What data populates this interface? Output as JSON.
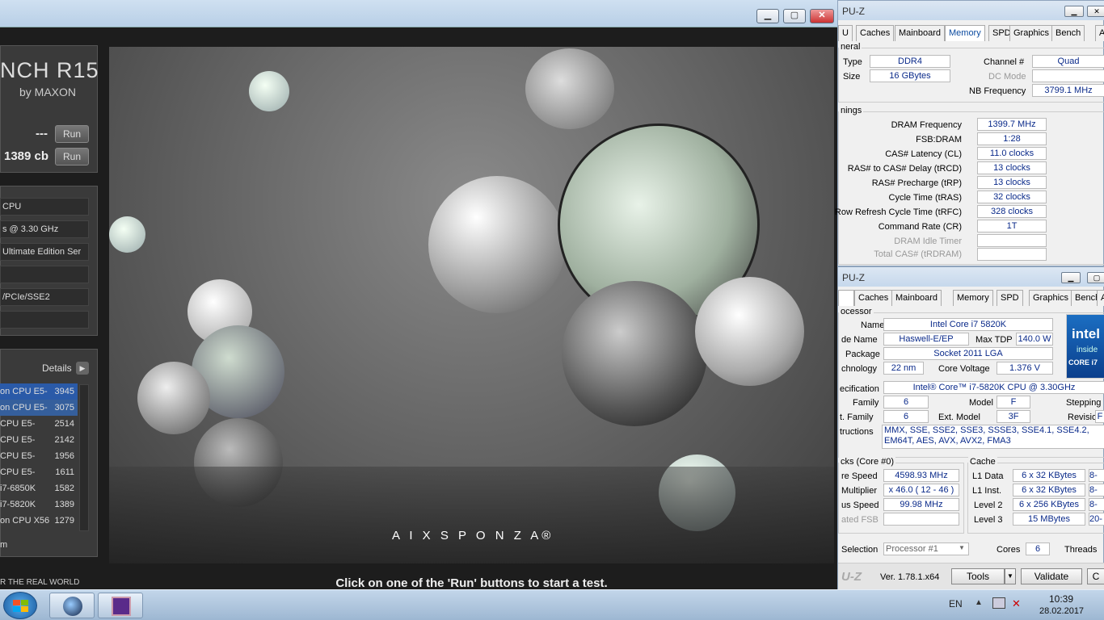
{
  "cinebench": {
    "logo": "NCH R15",
    "by": "by MAXON",
    "opengl_score": "---",
    "cpu_score": "1389 cb",
    "run_label": "Run",
    "info": [
      "CPU",
      "s @ 3.30 GHz",
      "Ultimate Edition Ser",
      "",
      "/PCIe/SSE2",
      ""
    ],
    "details_label": "Details",
    "ranking": [
      {
        "name": "on CPU E5-",
        "score": "3945"
      },
      {
        "name": "on CPU E5-",
        "score": "3075"
      },
      {
        "name": "CPU E5-",
        "score": "2514"
      },
      {
        "name": "CPU E5-",
        "score": "2142"
      },
      {
        "name": "CPU E5-",
        "score": "1956"
      },
      {
        "name": "CPU E5-",
        "score": "1611"
      },
      {
        "name": "i7-6850K",
        "score": "1582"
      },
      {
        "name": "i7-5820K",
        "score": "1389"
      },
      {
        "name": "on CPU X56",
        "score": "1279"
      }
    ],
    "bottom_item": "m",
    "tagline": "R THE REAL WORLD",
    "message": "Click on one of the 'Run' buttons to start a test.",
    "render_logo": "A I X S P O N Z A®",
    "highlight_color": "#2a5aa8"
  },
  "cpuz_memory": {
    "title": "PU-Z",
    "tabs": [
      "U",
      "Caches",
      "Mainboard",
      "Memory",
      "SPD",
      "Graphics",
      "Bench",
      "A"
    ],
    "active_tab": "Memory",
    "general_label": "neral",
    "type_label": "Type",
    "type": "DDR4",
    "size_label": "Size",
    "size": "16 GBytes",
    "channel_label": "Channel #",
    "channel": "Quad",
    "dcmode_label": "DC Mode",
    "dcmode": "",
    "nbfreq_label": "NB Frequency",
    "nbfreq": "3799.1 MHz",
    "timings_label": "nings",
    "timings": [
      {
        "label": "DRAM Frequency",
        "value": "1399.7 MHz",
        "grey": false
      },
      {
        "label": "FSB:DRAM",
        "value": "1:28",
        "grey": false
      },
      {
        "label": "CAS# Latency (CL)",
        "value": "11.0 clocks",
        "grey": false
      },
      {
        "label": "RAS# to CAS# Delay (tRCD)",
        "value": "13 clocks",
        "grey": false
      },
      {
        "label": "RAS# Precharge (tRP)",
        "value": "13 clocks",
        "grey": false
      },
      {
        "label": "Cycle Time (tRAS)",
        "value": "32 clocks",
        "grey": false
      },
      {
        "label": "Row Refresh Cycle Time (tRFC)",
        "value": "328 clocks",
        "grey": false
      },
      {
        "label": "Command Rate (CR)",
        "value": "1T",
        "grey": false
      },
      {
        "label": "DRAM Idle Timer",
        "value": "",
        "grey": true
      },
      {
        "label": "Total CAS# (tRDRAM)",
        "value": "",
        "grey": true
      }
    ]
  },
  "cpuz_cpu": {
    "title": "PU-Z",
    "tabs": [
      "",
      "Caches",
      "Mainboard",
      "Memory",
      "SPD",
      "Graphics",
      "Bench",
      "Ab"
    ],
    "processor_label": "ocessor",
    "name_label": "Name",
    "name": "Intel Core i7 5820K",
    "codename_label": "de Name",
    "codename": "Haswell-E/EP",
    "maxtdp_label": "Max TDP",
    "maxtdp": "140.0 W",
    "package_label": "Package",
    "package": "Socket 2011 LGA",
    "tech_label": "chnology",
    "tech": "22 nm",
    "voltage_label": "Core Voltage",
    "voltage": "1.376 V",
    "spec_label": "ecification",
    "spec": "Intel® Core™ i7-5820K CPU @ 3.30GHz",
    "family_label": "Family",
    "family": "6",
    "model_label": "Model",
    "model": "F",
    "stepping_label": "Stepping",
    "extfamily_label": "t. Family",
    "extfamily": "6",
    "extmodel_label": "Ext. Model",
    "extmodel": "3F",
    "revision_label": "Revision",
    "revision": "F",
    "instr_label": "tructions",
    "instr": "MMX, SSE, SSE2, SSE3, SSSE3, SSE4.1, SSE4.2, EM64T, AES, AVX, AVX2, FMA3",
    "clocks_label": "cks (Core #0)",
    "corespeed_label": "re Speed",
    "corespeed": "4598.93 MHz",
    "mult_label": "Multiplier",
    "mult": "x 46.0 ( 12 - 46 )",
    "bus_label": "us Speed",
    "bus": "99.98 MHz",
    "fsb_label": "ated FSB",
    "cache_label": "Cache",
    "caches": [
      {
        "label": "L1 Data",
        "value": "6 x 32 KBytes",
        "extra": "8-"
      },
      {
        "label": "L1 Inst.",
        "value": "6 x 32 KBytes",
        "extra": "8-"
      },
      {
        "label": "Level 2",
        "value": "6 x 256 KBytes",
        "extra": "8-"
      },
      {
        "label": "Level 3",
        "value": "15 MBytes",
        "extra": "20-"
      }
    ],
    "selection_label": "Selection",
    "selection": "Processor #1",
    "cores_label": "Cores",
    "cores": "6",
    "threads_label": "Threads",
    "logo_text": "intel",
    "logo_sub": "inside",
    "logo_core": "CORE i7",
    "brand": "U-Z",
    "version": "Ver. 1.78.1.x64",
    "tools_label": "Tools",
    "validate_label": "Validate",
    "close_label": "C"
  },
  "taskbar": {
    "lang": "EN",
    "time": "10:39",
    "date": "28.02.2017"
  }
}
